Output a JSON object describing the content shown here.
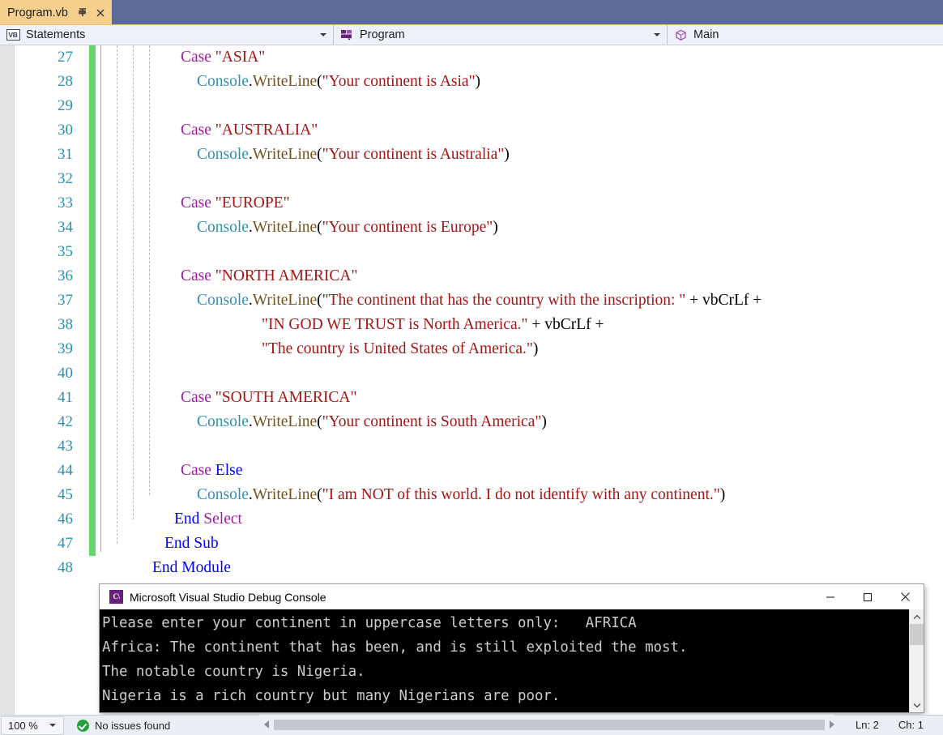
{
  "tab": {
    "label": "Program.vb",
    "pin_icon": "pin-icon",
    "close_icon": "close-icon"
  },
  "navbar": {
    "project_icon": "vb-file-icon",
    "project": "Statements",
    "type_icon": "module-icon",
    "type": "Program",
    "member_icon": "method-icon",
    "member": "Main"
  },
  "editor": {
    "first_line": 27,
    "lines": [
      {
        "n": 27,
        "indent": 2,
        "tokens": [
          {
            "t": "Case ",
            "c": "kw2"
          },
          {
            "t": "\"ASIA\"",
            "c": "str"
          }
        ]
      },
      {
        "n": 28,
        "indent": 3,
        "tokens": [
          {
            "t": "Console",
            "c": "cls"
          },
          {
            "t": ".",
            "c": "pun"
          },
          {
            "t": "WriteLine",
            "c": "mtd"
          },
          {
            "t": "(",
            "c": "pun"
          },
          {
            "t": "\"Your continent is Asia\"",
            "c": "str"
          },
          {
            "t": ")",
            "c": "pun"
          }
        ]
      },
      {
        "n": 29,
        "indent": 0,
        "tokens": []
      },
      {
        "n": 30,
        "indent": 2,
        "tokens": [
          {
            "t": "Case ",
            "c": "kw2"
          },
          {
            "t": "\"AUSTRALIA\"",
            "c": "str"
          }
        ]
      },
      {
        "n": 31,
        "indent": 3,
        "tokens": [
          {
            "t": "Console",
            "c": "cls"
          },
          {
            "t": ".",
            "c": "pun"
          },
          {
            "t": "WriteLine",
            "c": "mtd"
          },
          {
            "t": "(",
            "c": "pun"
          },
          {
            "t": "\"Your continent is Australia\"",
            "c": "str"
          },
          {
            "t": ")",
            "c": "pun"
          }
        ]
      },
      {
        "n": 32,
        "indent": 0,
        "tokens": []
      },
      {
        "n": 33,
        "indent": 2,
        "tokens": [
          {
            "t": "Case ",
            "c": "kw2"
          },
          {
            "t": "\"EUROPE\"",
            "c": "str"
          }
        ]
      },
      {
        "n": 34,
        "indent": 3,
        "tokens": [
          {
            "t": "Console",
            "c": "cls"
          },
          {
            "t": ".",
            "c": "pun"
          },
          {
            "t": "WriteLine",
            "c": "mtd"
          },
          {
            "t": "(",
            "c": "pun"
          },
          {
            "t": "\"Your continent is Europe\"",
            "c": "str"
          },
          {
            "t": ")",
            "c": "pun"
          }
        ]
      },
      {
        "n": 35,
        "indent": 0,
        "tokens": []
      },
      {
        "n": 36,
        "indent": 2,
        "tokens": [
          {
            "t": "Case ",
            "c": "kw2"
          },
          {
            "t": "\"NORTH AMERICA\"",
            "c": "str"
          }
        ]
      },
      {
        "n": 37,
        "indent": 3,
        "tokens": [
          {
            "t": "Console",
            "c": "cls"
          },
          {
            "t": ".",
            "c": "pun"
          },
          {
            "t": "WriteLine",
            "c": "mtd"
          },
          {
            "t": "(",
            "c": "pun"
          },
          {
            "t": "\"The continent that has the country with the inscription: \"",
            "c": "str"
          },
          {
            "t": " + ",
            "c": "pun"
          },
          {
            "t": "vbCrLf",
            "c": "ident"
          },
          {
            "t": " +",
            "c": "pun"
          }
        ]
      },
      {
        "n": 38,
        "indent": 7,
        "tokens": [
          {
            "t": "\"IN GOD WE TRUST is North America.\"",
            "c": "str"
          },
          {
            "t": " + ",
            "c": "pun"
          },
          {
            "t": "vbCrLf",
            "c": "ident"
          },
          {
            "t": " +",
            "c": "pun"
          }
        ]
      },
      {
        "n": 39,
        "indent": 7,
        "tokens": [
          {
            "t": "\"The country is United States of America.\"",
            "c": "str"
          },
          {
            "t": ")",
            "c": "pun"
          }
        ]
      },
      {
        "n": 40,
        "indent": 0,
        "tokens": []
      },
      {
        "n": 41,
        "indent": 2,
        "tokens": [
          {
            "t": "Case ",
            "c": "kw2"
          },
          {
            "t": "\"SOUTH AMERICA\"",
            "c": "str"
          }
        ]
      },
      {
        "n": 42,
        "indent": 3,
        "tokens": [
          {
            "t": "Console",
            "c": "cls"
          },
          {
            "t": ".",
            "c": "pun"
          },
          {
            "t": "WriteLine",
            "c": "mtd"
          },
          {
            "t": "(",
            "c": "pun"
          },
          {
            "t": "\"Your continent is South America\"",
            "c": "str"
          },
          {
            "t": ")",
            "c": "pun"
          }
        ]
      },
      {
        "n": 43,
        "indent": 0,
        "tokens": []
      },
      {
        "n": 44,
        "indent": 2,
        "tokens": [
          {
            "t": "Case ",
            "c": "kw2"
          },
          {
            "t": "Else",
            "c": "kw"
          }
        ]
      },
      {
        "n": 45,
        "indent": 3,
        "tokens": [
          {
            "t": "Console",
            "c": "cls"
          },
          {
            "t": ".",
            "c": "pun"
          },
          {
            "t": "WriteLine",
            "c": "mtd"
          },
          {
            "t": "(",
            "c": "pun"
          },
          {
            "t": "\"I am NOT of this world. I do not identify with any continent.\"",
            "c": "str"
          },
          {
            "t": ")",
            "c": "pun"
          }
        ]
      },
      {
        "n": 46,
        "indent": 1.6,
        "tokens": [
          {
            "t": "End ",
            "c": "kw"
          },
          {
            "t": "Select",
            "c": "kw2"
          }
        ]
      },
      {
        "n": 47,
        "indent": 1,
        "tokens": [
          {
            "t": "End Sub",
            "c": "kw"
          }
        ]
      },
      {
        "n": 48,
        "indent": 0.25,
        "tokens": [
          {
            "t": "End Module",
            "c": "kw"
          }
        ]
      }
    ]
  },
  "console": {
    "title": "Microsoft Visual Studio Debug Console",
    "app_icon_text": "C\\",
    "minimize_icon": "minimize-icon",
    "maximize_icon": "maximize-icon",
    "close_icon": "close-icon",
    "output": "Please enter your continent in uppercase letters only:   AFRICA\nAfrica: The continent that has been, and is still exploited the most.\nThe notable country is Nigeria.\nNigeria is a rich country but many Nigerians are poor.",
    "scrollbar_up_icon": "chevron-up-icon",
    "scrollbar_down_icon": "chevron-down-icon"
  },
  "statusbar": {
    "zoom": "100 %",
    "issues": "No issues found",
    "line": "Ln: 2",
    "column": "Ch: 1"
  },
  "colors": {
    "tab_active_bg": "#f5cf8e",
    "titlebar_bg": "#5d6c96",
    "navbar_bg": "#eef1f9",
    "keyword": "#0000ff",
    "keyword_alt": "#9b1ea0",
    "string": "#a31515",
    "class": "#2b91af",
    "method": "#74531f",
    "linenumber": "#2b91af",
    "change_bar": "#62d66a",
    "console_bg": "#000000",
    "console_fg": "#cccccc",
    "status_ok": "#23a23a"
  }
}
